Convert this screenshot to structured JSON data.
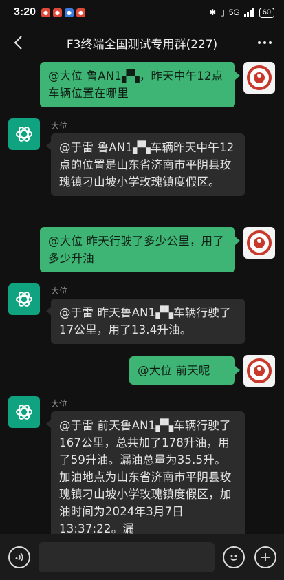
{
  "status_bar": {
    "time": "3:20",
    "network": "5G",
    "battery": "60"
  },
  "header": {
    "title": "F3终端全国测试专用群(227)"
  },
  "messages": [
    {
      "direction": "out",
      "text": "@大位  鲁AN1▞▚，昨天中午12点车辆位置在哪里"
    },
    {
      "direction": "in",
      "sender": "大位",
      "text": "@于雷  鲁AN1▞▚车辆昨天中午12点的位置是山东省济南市平阴县玫瑰镇刁山坡小学玫瑰镇度假区。"
    },
    {
      "direction": "out",
      "text": "@大位  昨天行驶了多少公里，用了多少升油"
    },
    {
      "direction": "in",
      "sender": "大位",
      "text": "@于雷  昨天鲁AN1▞▚车辆行驶了17公里，用了13.4升油。"
    },
    {
      "direction": "out",
      "text": "@大位  前天呢"
    },
    {
      "direction": "in",
      "sender": "大位",
      "text": "@于雷  前天鲁AN1▞▚车辆行驶了167公里，总共加了178升油，用了59升油。漏油总量为35.5升。加油地点为山东省济南市平阴县玫瑰镇刁山坡小学玫瑰镇度假区，加油时间为2024年3月7日13:37:22。漏"
    }
  ],
  "input": {
    "placeholder": ""
  },
  "colors": {
    "outgoing_bubble": "#3eb575",
    "incoming_bubble": "#2c2c2c",
    "bot_avatar": "#10a37f",
    "background": "#111111"
  }
}
